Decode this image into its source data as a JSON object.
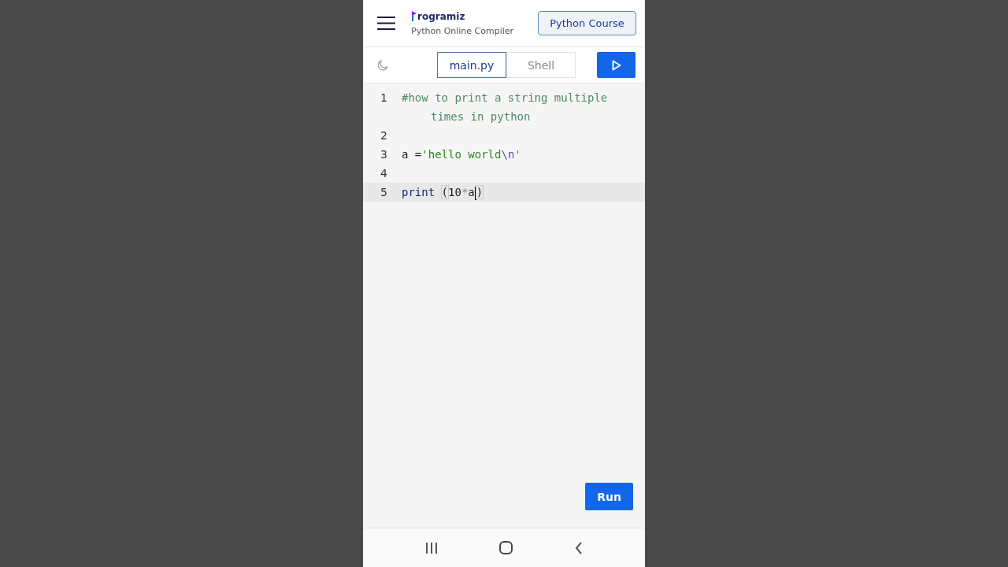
{
  "header": {
    "logo_text": "rogramiz",
    "subtitle": "Python Online Compiler",
    "course_button": "Python Course"
  },
  "tabs": [
    {
      "label": "main.py",
      "selected": true
    },
    {
      "label": "Shell",
      "selected": false
    }
  ],
  "editor": {
    "lines": [
      {
        "number": "1",
        "active": false,
        "tokens": [
          {
            "kind": "comment",
            "text": "#how to print a string multiple times in python"
          }
        ]
      },
      {
        "number": "2",
        "active": false
      },
      {
        "number": "3",
        "active": false,
        "tokens": [
          {
            "kind": "plain",
            "text": "a ="
          },
          {
            "kind": "string",
            "text": "'hello world"
          },
          {
            "kind": "escape",
            "text": "\\n"
          },
          {
            "kind": "string",
            "text": "'"
          }
        ]
      },
      {
        "number": "4",
        "active": false
      },
      {
        "number": "5",
        "active": true,
        "tokens": [
          {
            "kind": "keyword",
            "text": "print"
          },
          {
            "kind": "bracket",
            "text": "("
          },
          {
            "kind": "plain",
            "text": "10"
          },
          {
            "kind": "operator",
            "text": "*"
          },
          {
            "kind": "plain",
            "text": "a",
            "cursor": true
          },
          {
            "kind": "bracket",
            "text": ")"
          }
        ]
      }
    ]
  },
  "run_button": "Run"
}
